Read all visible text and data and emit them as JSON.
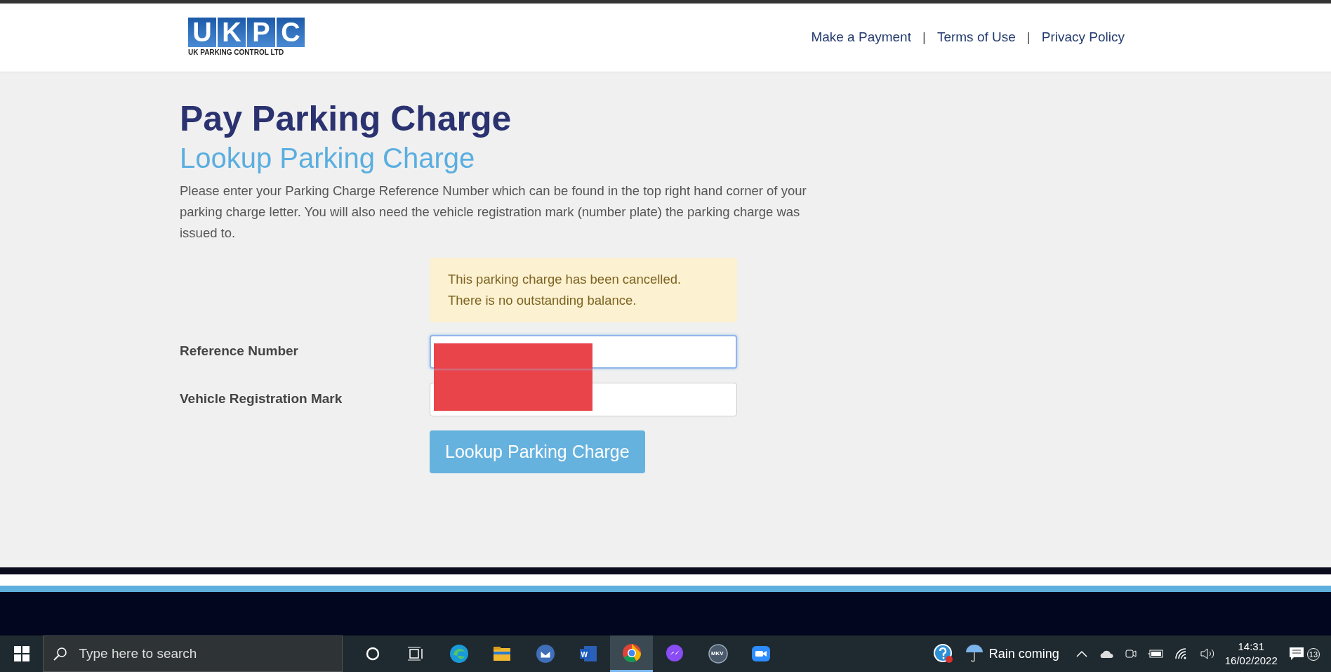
{
  "header": {
    "logo": {
      "letters": [
        "U",
        "K",
        "P",
        "C"
      ],
      "tagline": "UK PARKING CONTROL LTD"
    },
    "nav": [
      {
        "label": "Make a Payment"
      },
      {
        "label": "Terms of Use"
      },
      {
        "label": "Privacy Policy"
      }
    ],
    "separator": "|"
  },
  "page": {
    "title": "Pay Parking Charge",
    "subtitle": "Lookup Parking Charge",
    "intro": "Please enter your Parking Charge Reference Number which can be found in the top right hand corner of your parking charge letter. You will also need the vehicle registration mark (number plate) the parking charge was issued to.",
    "alert": {
      "lines": [
        "This parking charge has been cancelled.",
        "There is no outstanding balance."
      ]
    },
    "fields": [
      {
        "label": "Reference Number",
        "focused": true
      },
      {
        "label": "Vehicle Registration Mark",
        "focused": false
      }
    ],
    "redacted": true,
    "button": "Lookup Parking Charge"
  },
  "taskbar": {
    "search_placeholder": "Type here to search",
    "apps": [
      {
        "kind": "edge",
        "active": false
      },
      {
        "kind": "folder",
        "active": false
      },
      {
        "kind": "mail",
        "active": false
      },
      {
        "kind": "word",
        "active": false,
        "text": "W"
      },
      {
        "kind": "chrome",
        "active": true
      },
      {
        "kind": "messenger",
        "active": false
      },
      {
        "kind": "mkv",
        "active": false,
        "text": "MKV"
      },
      {
        "kind": "zoom",
        "active": false
      }
    ],
    "weather": "Rain coming",
    "time": "14:31",
    "date": "16/02/2022",
    "notifications": "13"
  }
}
